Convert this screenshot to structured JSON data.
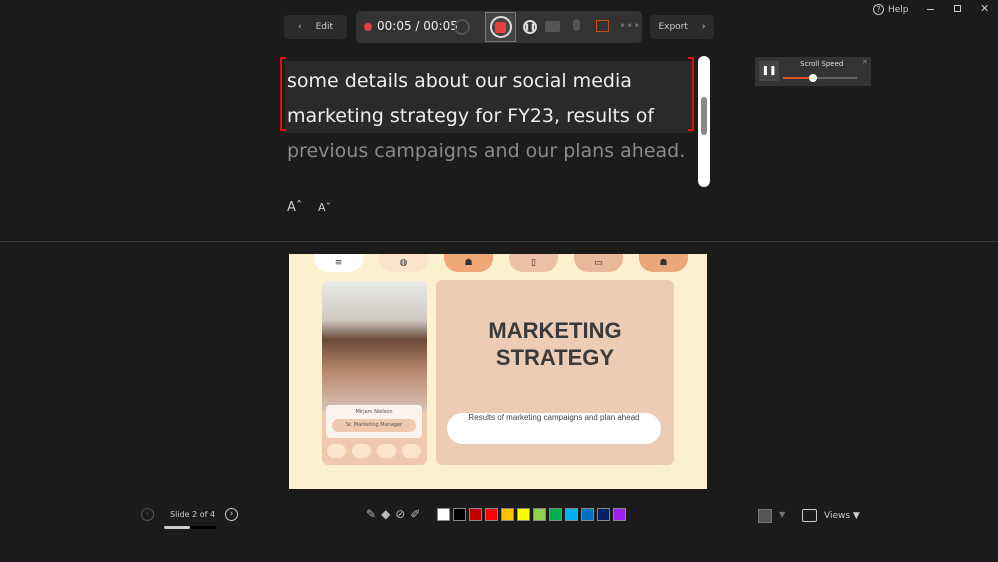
{
  "window": {
    "help_label": "Help"
  },
  "toolbar": {
    "edit_label": "Edit",
    "time": "00:05 / 00:05",
    "export_label": "Export"
  },
  "teleprompter": {
    "lines": [
      "some details about our social media",
      "marketing strategy for FY23, results of",
      "previous campaigns and our plans ahead."
    ],
    "increase_font": "Aˆ",
    "decrease_font": "Aˇ"
  },
  "scroll_speed": {
    "label": "Scroll Speed",
    "value_percent": 40
  },
  "slide": {
    "title_line1": "MARKETING",
    "title_line2": "STRATEGY",
    "subtitle": "Results of marketing campaigns and plan ahead",
    "presenter_name": "Mirjam Nielson",
    "presenter_role": "Sr. Marketing Manager"
  },
  "bottom": {
    "slide_indicator": "Slide 2 of 4",
    "progress_percent": 50,
    "views_label": "Views ▼",
    "ink_colors": [
      "#ffffff",
      "#000000",
      "#c00000",
      "#ff0000",
      "#ffc000",
      "#ffff00",
      "#92d050",
      "#00b050",
      "#00b0f0",
      "#0070c0",
      "#002060",
      "#a020f0"
    ]
  },
  "colors": {
    "record": "#e04040",
    "accent": "#e05020"
  }
}
